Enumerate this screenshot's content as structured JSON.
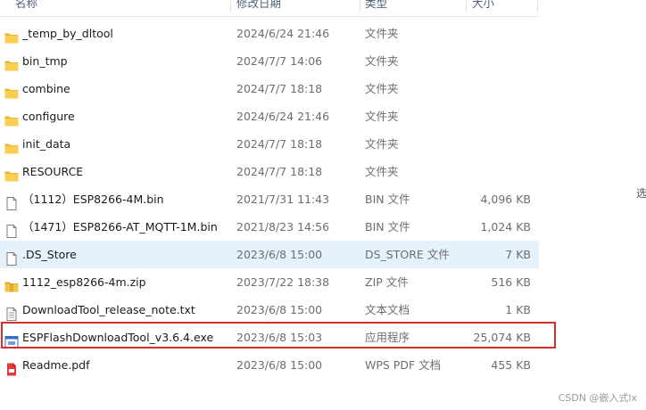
{
  "columns": {
    "name": "名称",
    "date": "修改日期",
    "type": "类型",
    "size": "大小"
  },
  "files": [
    {
      "name": "_temp_by_dltool",
      "date": "2024/6/24 21:46",
      "type": "文件夹",
      "size": "",
      "icon": "folder-icon"
    },
    {
      "name": "bin_tmp",
      "date": "2024/7/7 14:06",
      "type": "文件夹",
      "size": "",
      "icon": "folder-icon"
    },
    {
      "name": "combine",
      "date": "2024/7/7 18:18",
      "type": "文件夹",
      "size": "",
      "icon": "folder-icon"
    },
    {
      "name": "configure",
      "date": "2024/6/24 21:46",
      "type": "文件夹",
      "size": "",
      "icon": "folder-icon"
    },
    {
      "name": "init_data",
      "date": "2024/7/7 18:18",
      "type": "文件夹",
      "size": "",
      "icon": "folder-icon"
    },
    {
      "name": "RESOURCE",
      "date": "2024/7/7 18:18",
      "type": "文件夹",
      "size": "",
      "icon": "folder-icon"
    },
    {
      "name": "（1112）ESP8266-4M.bin",
      "date": "2021/7/31 11:43",
      "type": "BIN 文件",
      "size": "4,096 KB",
      "icon": "file-icon"
    },
    {
      "name": "（1471）ESP8266-AT_MQTT-1M.bin",
      "date": "2021/8/23 14:56",
      "type": "BIN 文件",
      "size": "1,024 KB",
      "icon": "file-icon"
    },
    {
      "name": ".DS_Store",
      "date": "2023/6/8 15:00",
      "type": "DS_STORE 文件",
      "size": "7 KB",
      "icon": "file-icon"
    },
    {
      "name": "1112_esp8266-4m.zip",
      "date": "2023/7/22 18:38",
      "type": "ZIP 文件",
      "size": "516 KB",
      "icon": "zip-icon"
    },
    {
      "name": "DownloadTool_release_note.txt",
      "date": "2023/6/8 15:00",
      "type": "文本文档",
      "size": "1 KB",
      "icon": "text-file-icon"
    },
    {
      "name": "ESPFlashDownloadTool_v3.6.4.exe",
      "date": "2023/6/8 15:03",
      "type": "应用程序",
      "size": "25,074 KB",
      "icon": "exe-icon"
    },
    {
      "name": "Readme.pdf",
      "date": "2023/6/8 15:00",
      "type": "WPS PDF 文档",
      "size": "455 KB",
      "icon": "pdf-icon"
    }
  ],
  "selected_index": 8,
  "highlighted_index": 11,
  "right_pane_char": "选",
  "watermark": "CSDN @嵌入式lx",
  "colors": {
    "selection": "#e5f1fb",
    "highlight_border": "#d32f2f",
    "folder": "#f5c542"
  }
}
